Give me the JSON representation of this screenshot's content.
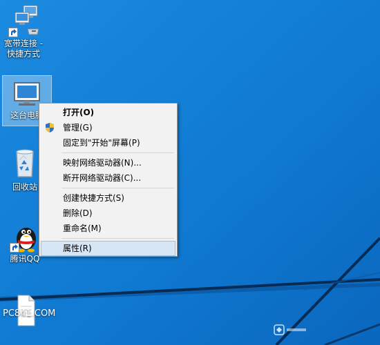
{
  "desktop": {
    "icons": [
      {
        "label": "宽带连接 -\n快捷方式",
        "icon": "network-connection-icon"
      },
      {
        "label": "这台电脑",
        "icon": "computer-icon"
      },
      {
        "label": "回收站",
        "icon": "recycle-bin-icon"
      },
      {
        "label": "腾讯QQ",
        "icon": "qq-penguin-icon"
      },
      {
        "label": "",
        "icon": "document-file-icon"
      }
    ]
  },
  "context_menu": {
    "items": [
      {
        "label": "打开(O)"
      },
      {
        "label": "管理(G)",
        "icon": "uac-shield-icon"
      },
      {
        "label": "固定到\"开始\"屏幕(P)"
      },
      {
        "label": "映射网络驱动器(N)..."
      },
      {
        "label": "断开网络驱动器(C)..."
      },
      {
        "label": "创建快捷方式(S)"
      },
      {
        "label": "删除(D)"
      },
      {
        "label": "重命名(M)"
      },
      {
        "label": "属性(R)"
      }
    ]
  },
  "watermark": {
    "left": "PC841.COM"
  },
  "colors": {
    "desktop_background": "#0f7fd6",
    "menu_background": "#f2f2f2",
    "menu_highlight": "#d7e6f4"
  }
}
